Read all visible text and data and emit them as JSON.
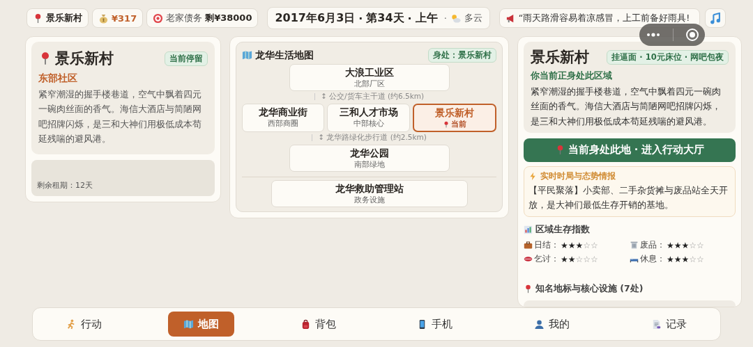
{
  "top_bar": {
    "location": "景乐新村",
    "money": "¥317",
    "debt": {
      "label": "老家债务",
      "value": "剩¥38000"
    },
    "date": "2017年6月3日",
    "separator": "·",
    "day": "第34天",
    "period": "上午",
    "weather": "多云",
    "message": "“雨天路滑容易着凉感冒，上工前备好雨具!"
  },
  "location_card": {
    "title": "景乐新村",
    "badge": "当前停留",
    "region": "东部社区",
    "description": "紧窄潮湿的握手楼巷道，空气中飘着四元一碗肉丝面的香气。海信大酒店与简陋网吧招牌闪烁，是三和大神们用极低成本苟延残喘的避风港。",
    "lease": "剩余租期：12天"
  },
  "map": {
    "title": "龙华生活地图",
    "badge": "身处：景乐新村",
    "rows": [
      {
        "kind": "nodes",
        "nodes": [
          {
            "name": "大浪工业区",
            "sub": "北部厂区",
            "selected": false
          }
        ]
      },
      {
        "kind": "road",
        "text": "↕ 公交/货车主干道 (约6.5km)"
      },
      {
        "kind": "nodes",
        "nodes": [
          {
            "name": "龙华商业街",
            "sub": "西部商圈",
            "selected": false
          },
          {
            "name": "三和人才市场",
            "sub": "中部核心",
            "selected": false
          },
          {
            "name": "景乐新村",
            "sub": "当前",
            "selected": true
          }
        ]
      },
      {
        "kind": "road",
        "text": "↕ 龙华路绿化步行道 (约2.5km)"
      },
      {
        "kind": "nodes",
        "nodes": [
          {
            "name": "龙华公园",
            "sub": "南部绿地",
            "selected": false
          }
        ]
      },
      {
        "kind": "divider"
      },
      {
        "kind": "nodes",
        "nodes": [
          {
            "name": "龙华救助管理站",
            "sub": "政务设施",
            "selected": false
          }
        ]
      }
    ]
  },
  "detail": {
    "title": "景乐新村",
    "tags": "挂逼面 · 10元床位 · 网吧包夜",
    "status": "你当前正身处此区域",
    "description": "紧窄潮湿的握手楼巷道，空气中飘着四元一碗肉丝面的香气。海信大酒店与简陋网吧招牌闪烁，是三和大神们用极低成本苟延残喘的避风港。",
    "action_button": "当前身处此地 · 进入行动大厅",
    "intel": {
      "title": "实时时局与态势情报",
      "text": "【平民聚落】小卖部、二手杂货摊与废品站全天开放，是大神们最低生存开销的基地。"
    },
    "stats_title": "区域生存指数",
    "stats": [
      {
        "label": "日结：",
        "stars": 3
      },
      {
        "label": "废品：",
        "stars": 3
      },
      {
        "label": "乞讨：",
        "stars": 2
      },
      {
        "label": "休息：",
        "stars": 3
      }
    ],
    "landmarks_title": "知名地标与核心设施 (7处)"
  },
  "nav": [
    {
      "label": "行动",
      "selected": false
    },
    {
      "label": "地图",
      "selected": true
    },
    {
      "label": "背包",
      "selected": false
    },
    {
      "label": "手机",
      "selected": false
    },
    {
      "label": "我的",
      "selected": false
    },
    {
      "label": "记录",
      "selected": false
    }
  ]
}
